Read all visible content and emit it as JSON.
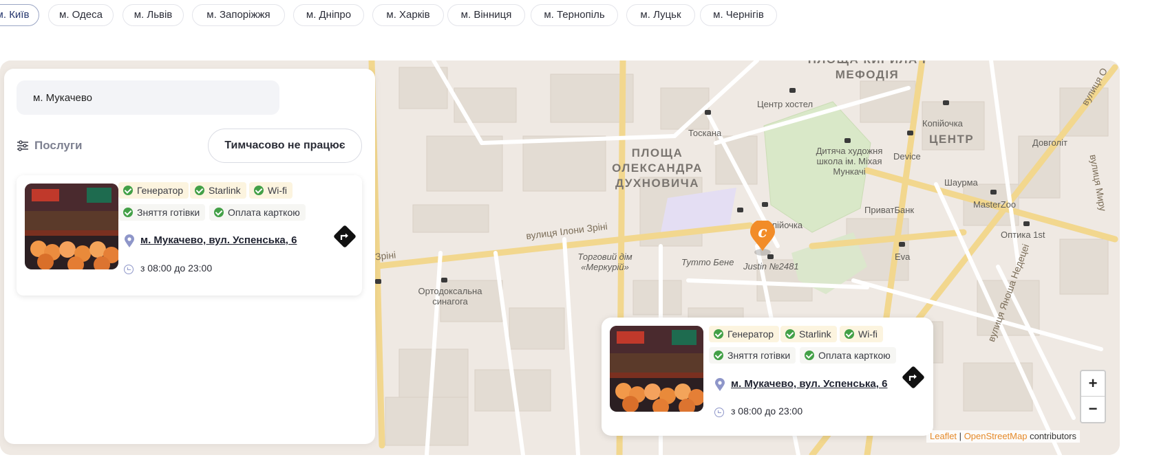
{
  "cities": [
    {
      "label": "м. Київ",
      "active": true
    },
    {
      "label": "м. Одеса"
    },
    {
      "label": "м. Львів"
    },
    {
      "label": "м. Запоріжжя"
    },
    {
      "label": "м. Дніпро"
    },
    {
      "label": "м. Харків"
    },
    {
      "label": "м. Вінниця"
    },
    {
      "label": "м. Тернопіль"
    },
    {
      "label": "м. Луцьк"
    },
    {
      "label": "м. Чернігів"
    }
  ],
  "panel": {
    "search_value": "м. Мукачево",
    "services_label": "Послуги",
    "temp_closed_label": "Тимчасово не працює"
  },
  "store": {
    "tags": [
      "Генератор",
      "Starlink",
      "Wi-fi",
      "Зняття готівки",
      "Оплата карткою"
    ],
    "address": "м. Мукачево, вул. Успенська, 6",
    "hours": "з 08:00 до 23:00"
  },
  "map": {
    "labels": {
      "sq_kyryla": "ПЛОЩА КИРИЛА І МЕФОДІЯ",
      "sq_dukhnovycha": "ПЛОЩА ОЛЕКСАНДРА ДУХНОВИЧА",
      "centr": "ЦЕНТР",
      "hostel": "Центр хостел",
      "toskana": "Тоскана",
      "kopiyochka": "Копійочка",
      "device": "Device",
      "shaurma": "Шаурма",
      "dovgolit": "Довголіт",
      "art_school": "Дитяча художня школа ім. Міхая Мункачі",
      "privatbank": "ПриватБанк",
      "masterzoo": "MasterZoo",
      "optyka": "Оптика 1st",
      "street_ilony": "вулиця Ілони Зріні",
      "zrini": "Зріні",
      "trade_house": "Торговий дім «Меркурій»",
      "tutto": "Тутто Бене",
      "justin": "Justin №2481",
      "kopiychka2": "пійочка",
      "eva": "Eva",
      "synagogue": "Ортодоксальна синагога",
      "street_myru": "вулиця Миру",
      "street_nedetsei": "вулиця Яноша Недецеі",
      "street_o": "вулиця О",
      "zriny_left": "Зріні"
    },
    "zoom_in": "+",
    "zoom_out": "−",
    "attribution": {
      "leaflet": "Leaflet",
      "sep": "|",
      "osm": "OpenStreetMap",
      "rest": "contributors"
    }
  },
  "colors": {
    "accent": "#f28c28",
    "check": "#43a047",
    "pin": "#8e96c9"
  }
}
